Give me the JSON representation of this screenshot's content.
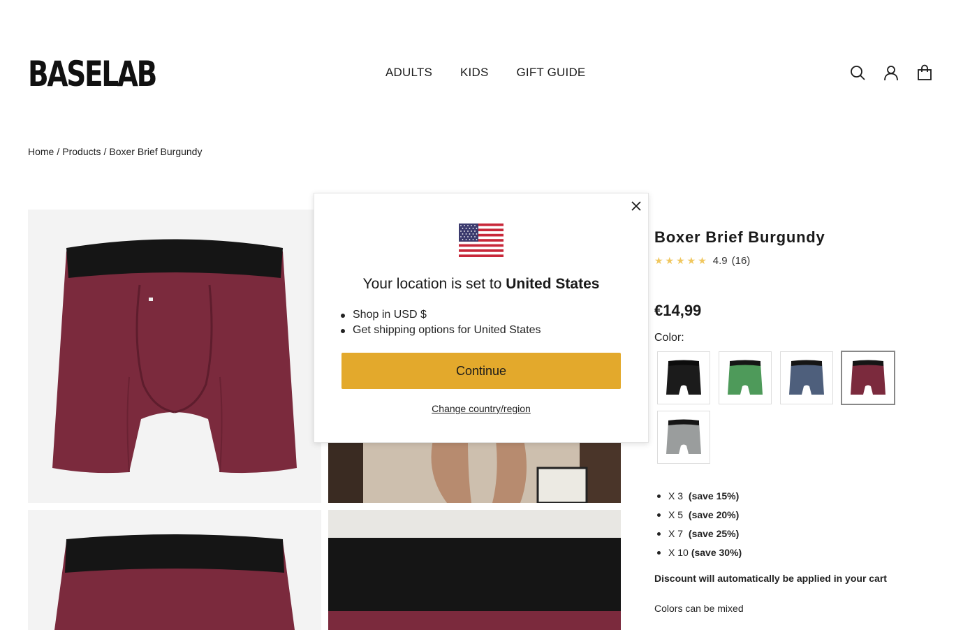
{
  "header": {
    "logo": "BASELAB",
    "nav": [
      "ADULTS",
      "KIDS",
      "GIFT GUIDE"
    ],
    "icons": [
      "search-icon",
      "account-icon",
      "cart-icon"
    ]
  },
  "breadcrumb": {
    "home": "Home",
    "products": "Products",
    "current": "Boxer Brief Burgundy",
    "separator": "/"
  },
  "product": {
    "title": "Boxer Brief Burgundy",
    "rating": "4.9",
    "reviews": "(16)",
    "stars": "★★★★★",
    "price": "€14,99",
    "color_label": "Color:",
    "colors": [
      {
        "name": "black",
        "hex": "#1b1b1b"
      },
      {
        "name": "green",
        "hex": "#4e9a5a"
      },
      {
        "name": "blue-grey",
        "hex": "#4e5f7c"
      },
      {
        "name": "burgundy",
        "hex": "#7b2a3d",
        "selected": true
      },
      {
        "name": "grey",
        "hex": "#9a9d9d"
      }
    ],
    "bundles": [
      {
        "qty": "X 3",
        "save": "(save 15%)"
      },
      {
        "qty": "X 5",
        "save": "(save 20%)"
      },
      {
        "qty": "X 7",
        "save": "(save 25%)"
      },
      {
        "qty": "X 10",
        "save": "(save 30%)"
      }
    ],
    "discount_note": "Discount will automatically be applied in your cart",
    "mix_note": "Colors can be mixed"
  },
  "modal": {
    "title_prefix": "Your location is set to",
    "country": "United States",
    "items": [
      "Shop in USD $",
      "Get shipping options for United States"
    ],
    "continue_label": "Continue",
    "change_label": "Change country/region"
  },
  "colors": {
    "accent": "#e3a92c",
    "burgundy": "#7b2a3d",
    "waistband": "#151515"
  }
}
